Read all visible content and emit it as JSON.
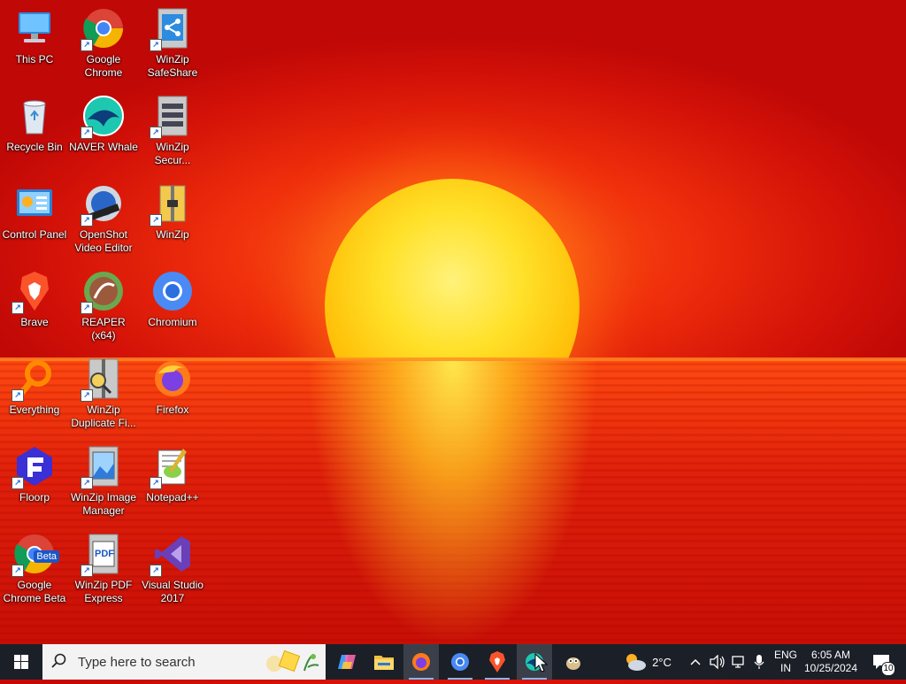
{
  "desktop": {
    "icons": [
      {
        "label": "This PC"
      },
      {
        "label": "Google Chrome"
      },
      {
        "label": "WinZip SafeShare"
      },
      {
        "label": "Recycle Bin"
      },
      {
        "label": "NAVER Whale"
      },
      {
        "label": "WinZip Secur..."
      },
      {
        "label": "Control Panel"
      },
      {
        "label": "OpenShot Video Editor"
      },
      {
        "label": "WinZip"
      },
      {
        "label": "Brave"
      },
      {
        "label": "REAPER (x64)"
      },
      {
        "label": "Chromium"
      },
      {
        "label": "Everything"
      },
      {
        "label": "WinZip Duplicate Fi..."
      },
      {
        "label": "Firefox"
      },
      {
        "label": "Floorp"
      },
      {
        "label": "WinZip Image Manager"
      },
      {
        "label": "Notepad++"
      },
      {
        "label": "Google Chrome Beta"
      },
      {
        "label": "WinZip PDF Express"
      },
      {
        "label": "Visual Studio 2017"
      }
    ],
    "beta_badge": "Beta",
    "pdf_badge": "PDF"
  },
  "taskbar": {
    "search_placeholder": "Type here to search",
    "pinned": [
      "copilot-icon",
      "file-explorer-icon",
      "firefox-icon",
      "chromium-icon",
      "brave-icon",
      "whale-icon",
      "gimp-icon"
    ],
    "weather": "2°C",
    "language_top": "ENG",
    "language_bottom": "IN",
    "time": "6:05 AM",
    "date": "10/25/2024",
    "notifications": "10"
  },
  "colors": {
    "taskbar_bg": "#1b1f27",
    "accent": "#7db9ff"
  }
}
